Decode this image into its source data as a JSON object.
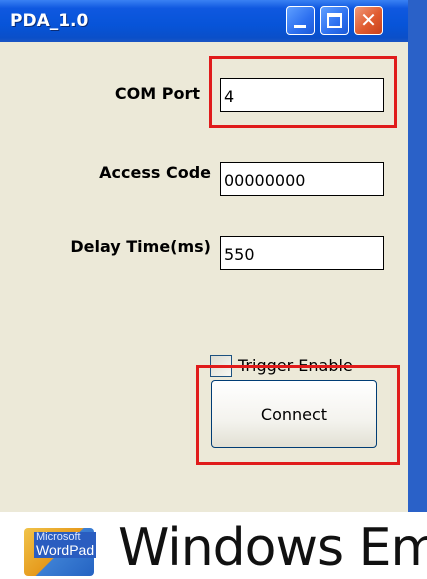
{
  "window": {
    "title": "PDA_1.0"
  },
  "form": {
    "com_port": {
      "label": "COM Port",
      "value": "4"
    },
    "access_code": {
      "label": "Access Code",
      "value": "00000000"
    },
    "delay_time": {
      "label": "Delay Time(ms)",
      "value": "550"
    },
    "trigger_enable": {
      "label": "Trigger Enable",
      "checked": false
    },
    "connect_label": "Connect"
  },
  "desktop": {
    "icon_label_top": "Microsoft",
    "icon_label": "WordPad",
    "watermark": "Windows Em"
  },
  "colors": {
    "highlight": "#e01b1b",
    "titlebar": "#0754d8",
    "window_bg": "#ece9d8",
    "desktop": "#2a61c8"
  }
}
